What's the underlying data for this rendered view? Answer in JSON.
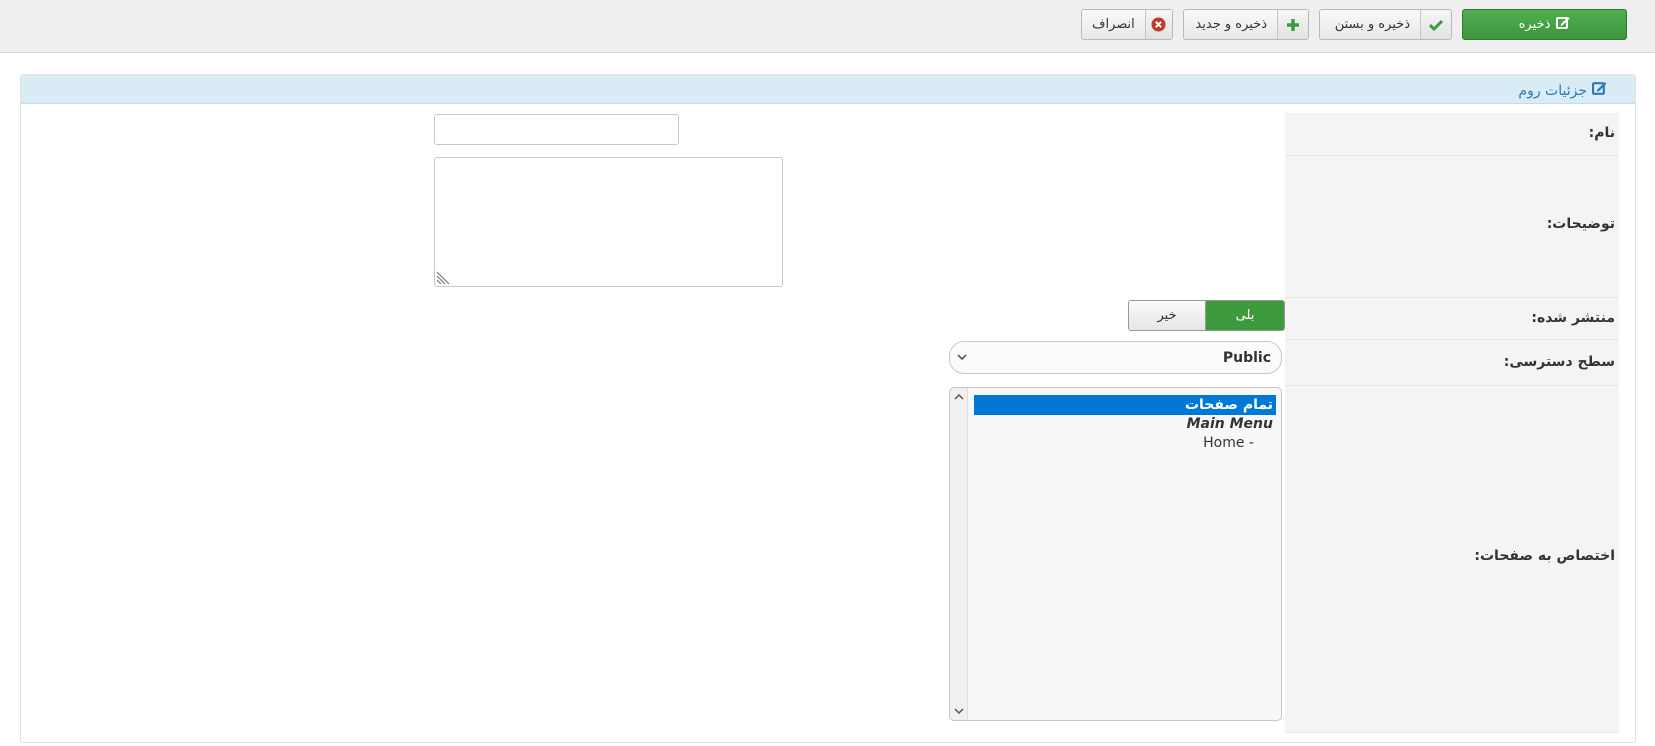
{
  "toolbar": {
    "save_label": "ذخیره",
    "save_close_label": "ذخیره و بستن",
    "save_new_label": "ذخیره و جدید",
    "cancel_label": "انصراف",
    "icons": {
      "save": "edit-icon",
      "save_close": "check-icon",
      "save_new": "plus-icon",
      "cancel": "close-circle-icon"
    }
  },
  "panel": {
    "title": "جزئیات روم",
    "title_icon": "edit-icon"
  },
  "form": {
    "name_label": "نام:",
    "name_value": "",
    "description_label": "توضیحات:",
    "description_value": "",
    "published_label": "منتشر شده:",
    "published_yes": "بلی",
    "published_no": "خیر",
    "published_value": "yes",
    "access_label": "سطح دسترسی:",
    "access_value": "Public",
    "assignment_label": "اختصاص به صفحات:",
    "assignment_options": [
      "تمام صفحات",
      "Main Menu",
      "- Home"
    ],
    "assignment_selected": "تمام صفحات"
  },
  "colors": {
    "accent_green": "#3d9a3d",
    "panel_header_bg": "#d9ebf5",
    "panel_title": "#2a7ab3",
    "selection_blue": "#0078d7",
    "cancel_red": "#c0392b"
  }
}
